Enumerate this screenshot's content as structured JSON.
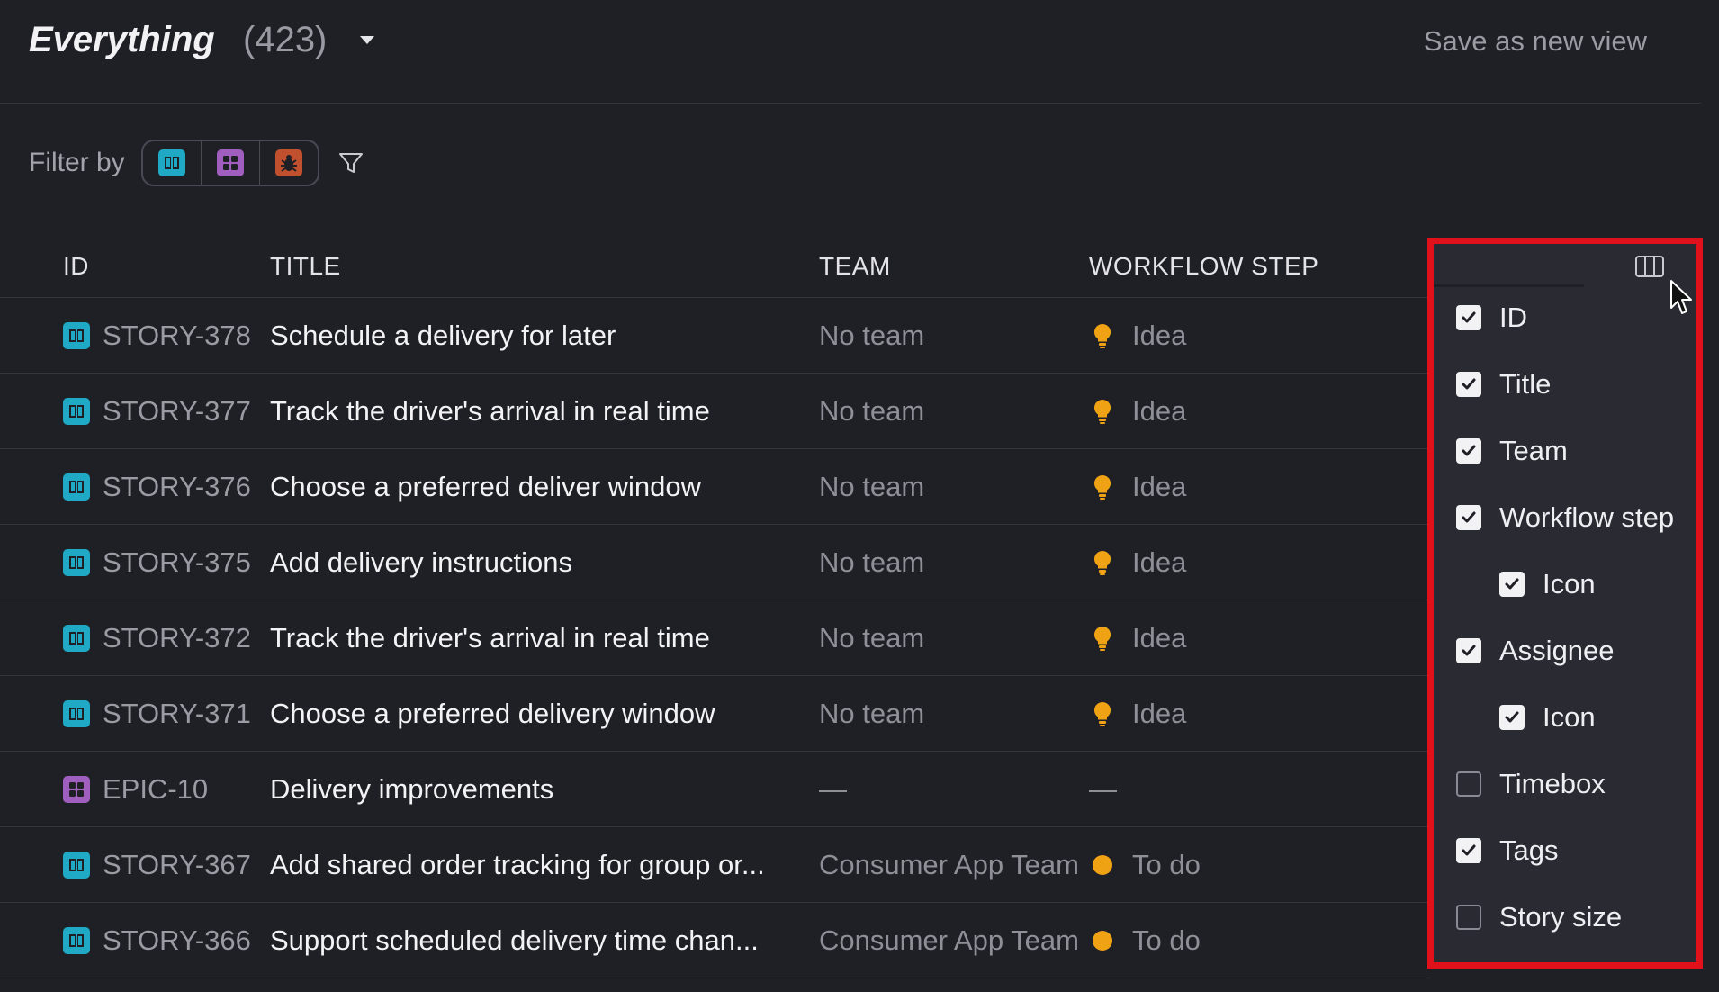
{
  "header": {
    "view_name": "Everything",
    "count": "(423)",
    "save_view_label": "Save as new view"
  },
  "filter": {
    "label": "Filter by",
    "types": [
      "story-icon",
      "epic-icon",
      "bug-icon"
    ]
  },
  "table": {
    "columns": [
      "ID",
      "TITLE",
      "TEAM",
      "WORKFLOW STEP"
    ],
    "rows": [
      {
        "type": "story",
        "id": "STORY-378",
        "title": "Schedule a delivery for later",
        "team": "No team",
        "step_icon": "lightbulb-icon",
        "step": "Idea"
      },
      {
        "type": "story",
        "id": "STORY-377",
        "title": "Track the driver's arrival in real time",
        "team": "No team",
        "step_icon": "lightbulb-icon",
        "step": "Idea"
      },
      {
        "type": "story",
        "id": "STORY-376",
        "title": "Choose a preferred deliver window",
        "team": "No team",
        "step_icon": "lightbulb-icon",
        "step": "Idea"
      },
      {
        "type": "story",
        "id": "STORY-375",
        "title": "Add delivery instructions",
        "team": "No team",
        "step_icon": "lightbulb-icon",
        "step": "Idea"
      },
      {
        "type": "story",
        "id": "STORY-372",
        "title": "Track the driver's arrival in real time",
        "team": "No team",
        "step_icon": "lightbulb-icon",
        "step": "Idea"
      },
      {
        "type": "story",
        "id": "STORY-371",
        "title": "Choose a preferred delivery window",
        "team": "No team",
        "step_icon": "lightbulb-icon",
        "step": "Idea"
      },
      {
        "type": "epic",
        "id": "EPIC-10",
        "title": "Delivery improvements",
        "team": "—",
        "step_icon": "",
        "step": "—"
      },
      {
        "type": "story",
        "id": "STORY-367",
        "title": "Add shared order tracking for group or...",
        "team": "Consumer App Team",
        "step_icon": "dot-icon",
        "step": "To do"
      },
      {
        "type": "story",
        "id": "STORY-366",
        "title": "Support scheduled delivery time chan...",
        "team": "Consumer App Team",
        "step_icon": "dot-icon",
        "step": "To do"
      }
    ]
  },
  "column_menu": {
    "options": [
      {
        "label": "ID",
        "checked": true,
        "indent": false
      },
      {
        "label": "Title",
        "checked": true,
        "indent": false
      },
      {
        "label": "Team",
        "checked": true,
        "indent": false
      },
      {
        "label": "Workflow step",
        "checked": true,
        "indent": false
      },
      {
        "label": "Icon",
        "checked": true,
        "indent": true
      },
      {
        "label": "Assignee",
        "checked": true,
        "indent": false
      },
      {
        "label": "Icon",
        "checked": true,
        "indent": true
      },
      {
        "label": "Timebox",
        "checked": false,
        "indent": false
      },
      {
        "label": "Tags",
        "checked": true,
        "indent": false
      },
      {
        "label": "Story size",
        "checked": false,
        "indent": false
      }
    ]
  },
  "colors": {
    "story": "#1fa9c4",
    "epic": "#a05fbf",
    "bug": "#c0502e",
    "idea": "#f0a215",
    "todo": "#f0a215",
    "highlight": "#e0111b"
  }
}
